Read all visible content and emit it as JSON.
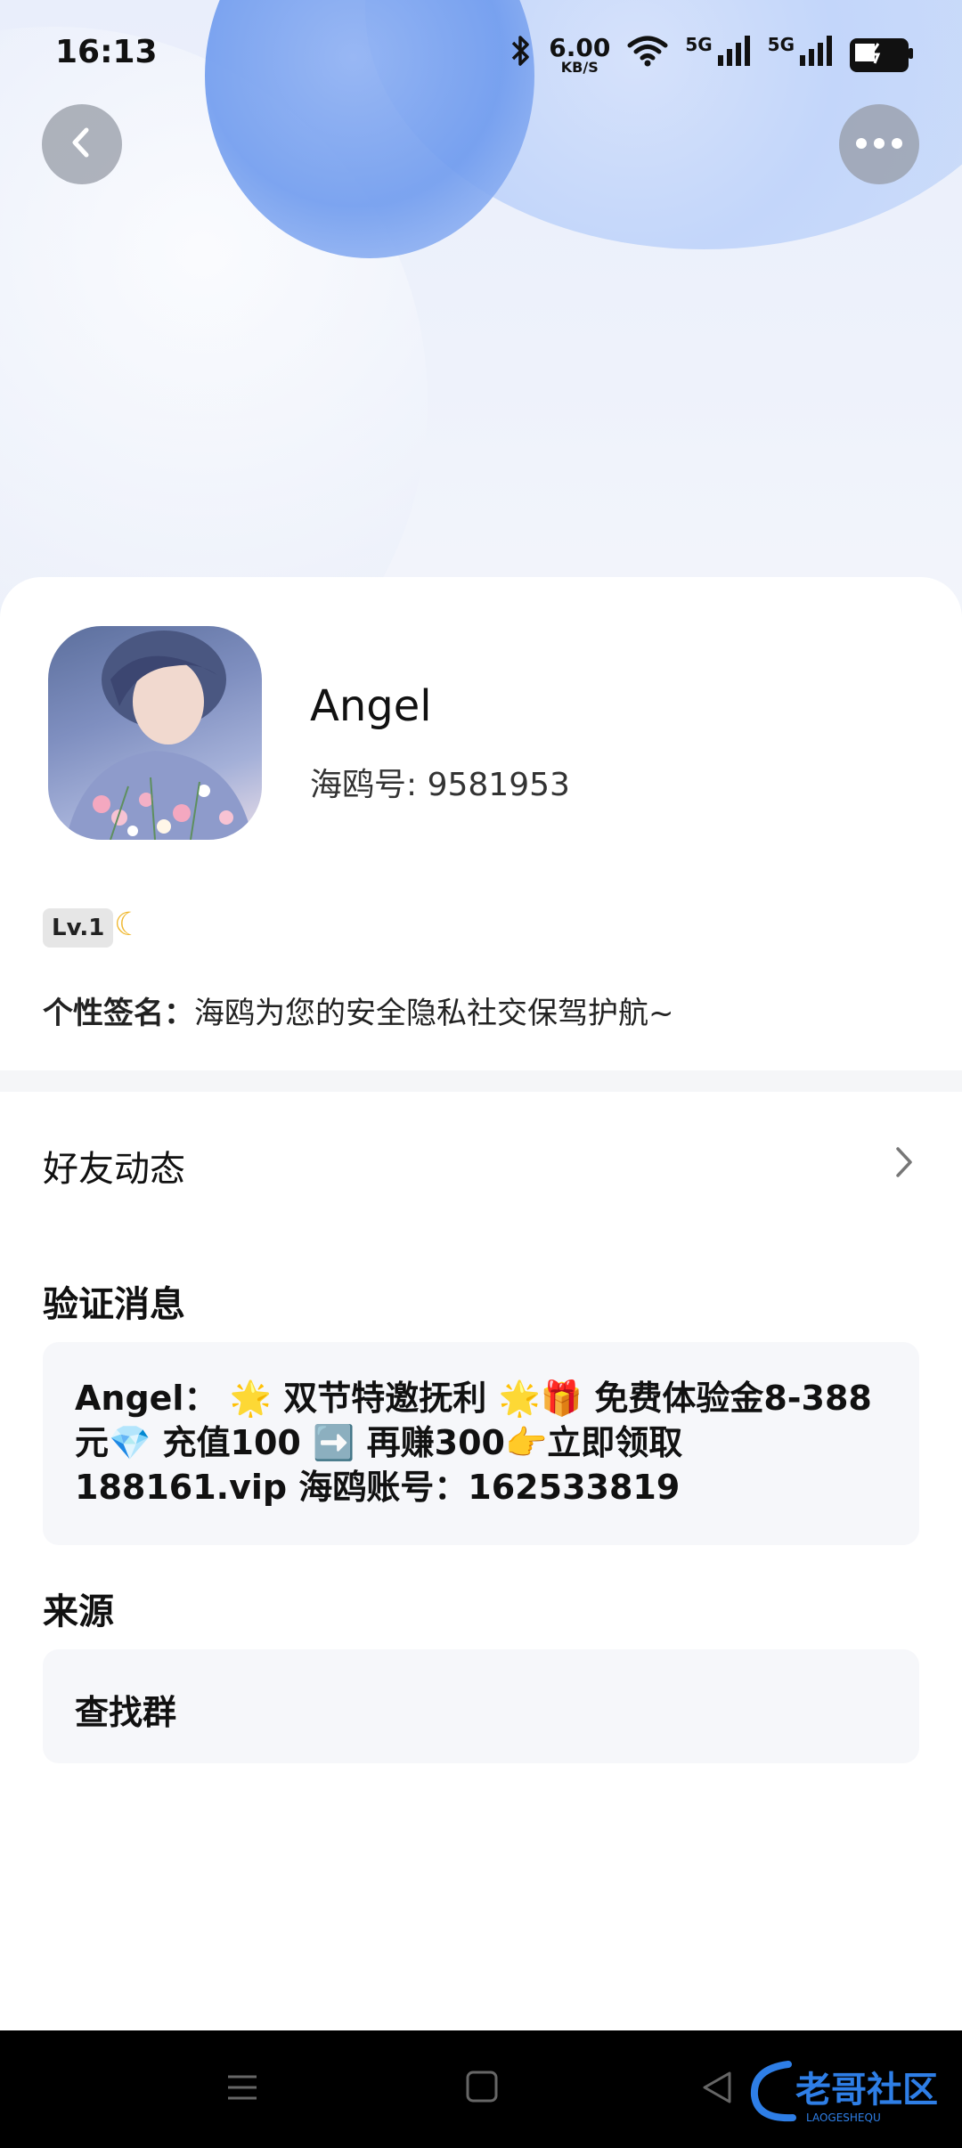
{
  "status_bar": {
    "time": "16:13",
    "speed_value": "6.00",
    "speed_unit": "KB/S",
    "signal1": "5G",
    "signal2": "5G"
  },
  "profile": {
    "name": "Angel",
    "uid": "海鸥号: 9581953",
    "level": "Lv.1",
    "signature_label": "个性签名：",
    "signature_text": "海鸥为您的安全隐私社交保驾护航~"
  },
  "friends_row": {
    "label": "好友动态"
  },
  "verification": {
    "title": "验证消息",
    "message": "Angel： 🌟 双节特邀抚利 🌟🎁 免费体验金8-388元💎 充值100 ➡️ 再赚300👉立即领取188161.vip  海鸥账号：162533819"
  },
  "source": {
    "title": "来源",
    "value": "查找群"
  },
  "watermark": {
    "title": "老哥社区",
    "subtitle": "LAOGESHEQU"
  },
  "colors": {
    "accent_blue": "#6f9bee",
    "card_bg": "#ffffff",
    "box_bg": "#f6f7fa"
  }
}
